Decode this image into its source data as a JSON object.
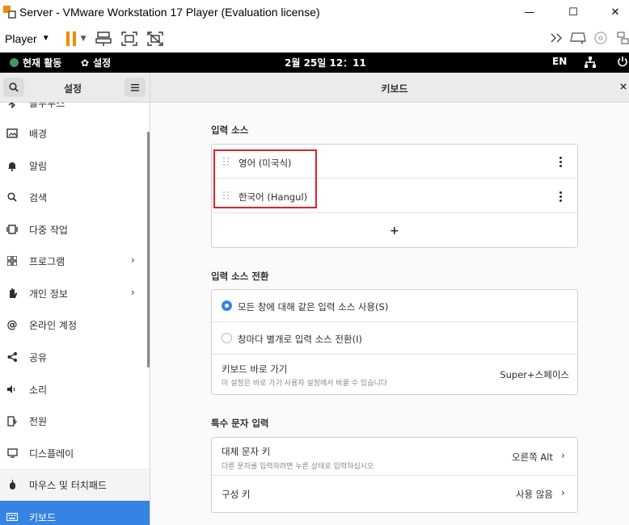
{
  "window": {
    "title": "Server - VMware Workstation 17 Player (Evaluation license)",
    "minimize": "—",
    "maximize": "☐",
    "close": "✕"
  },
  "toolbar": {
    "player_label": "Player",
    "icons": [
      "pause-icon",
      "send-keys-icon",
      "fullscreen-icon",
      "unity-icon"
    ],
    "right_icons": [
      "expand-icon",
      "removable-device-icon",
      "cd-icon",
      "network-icon"
    ]
  },
  "gnome_bar": {
    "activities": "현재 활동",
    "app_menu": "설정",
    "clock": "2월 25일  12：11",
    "input_lang": "EN"
  },
  "settings": {
    "sidebar_title": "설정",
    "main_title": "키보드",
    "close_glyph": "×",
    "sidebar_items": [
      {
        "label": "블루투스",
        "icon": "bluetooth-icon"
      },
      {
        "label": "배경",
        "icon": "background-icon"
      },
      {
        "label": "알림",
        "icon": "bell-icon"
      },
      {
        "label": "검색",
        "icon": "search-icon"
      },
      {
        "label": "다중 작업",
        "icon": "multitasking-icon"
      },
      {
        "label": "프로그램",
        "icon": "apps-grid-icon",
        "chevron": "›"
      },
      {
        "label": "개인 정보",
        "icon": "hand-icon",
        "chevron": "›"
      },
      {
        "label": "온라인 계정",
        "icon": "at-icon"
      },
      {
        "label": "공유",
        "icon": "share-icon"
      },
      {
        "label": "소리",
        "icon": "speaker-icon"
      },
      {
        "label": "전원",
        "icon": "power-icon"
      },
      {
        "label": "디스플레이",
        "icon": "display-icon"
      },
      {
        "label": "마우스 및 터치패드",
        "icon": "mouse-icon"
      },
      {
        "label": "키보드",
        "icon": "keyboard-icon"
      }
    ],
    "input_sources": {
      "title": "입력 소스",
      "items": [
        "영어 (미국식)",
        "한국어 (Hangul)"
      ],
      "add": "+"
    },
    "source_switching": {
      "title": "입력 소스 전환",
      "option_same": "모든 창에 대해 같은 입력 소스 사용(S)",
      "option_per_window": "창마다 별개로 입력 소스 전환(I)",
      "shortcut_label": "키보드 바로 가기",
      "shortcut_desc": "이 설정은 바로 가기 사용자 설정에서 바꿀 수 있습니다",
      "shortcut_value": "Super+스페이스"
    },
    "special_chars": {
      "title": "특수 문자 입력",
      "alt_chars_label": "대체 문자 키",
      "alt_chars_desc": "다른 문자를 입력하려면 누른 상태로 입력하십시오",
      "alt_chars_value": "오른쪽 Alt",
      "compose_label": "구성 키",
      "compose_value": "사용 않음",
      "chevron": "›"
    }
  },
  "colors": {
    "accent": "#3584e4",
    "highlight_box": "#e3202a",
    "vmware_orange": "#f38b00"
  }
}
